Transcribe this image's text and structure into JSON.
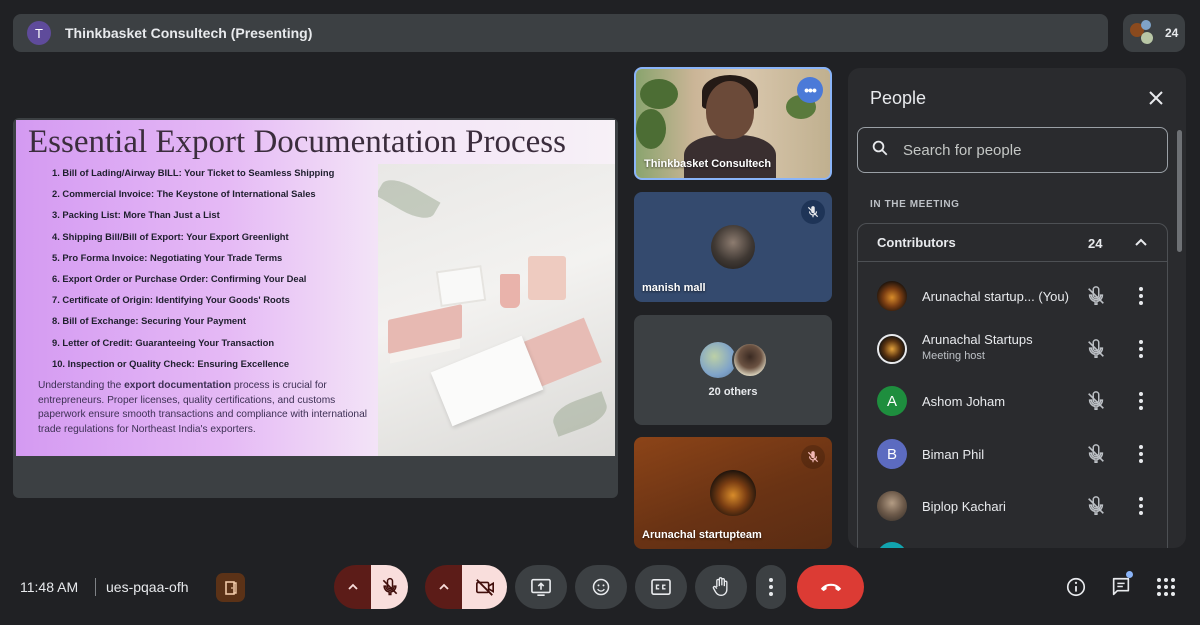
{
  "top_bar": {
    "presenter_initial": "T",
    "presenter_label": "Thinkbasket Consultech (Presenting)",
    "participant_count": "24"
  },
  "slide": {
    "title": "Essential Export Documentation Process",
    "items": [
      "1. Bill of Lading/Airway BILL: Your Ticket to Seamless Shipping",
      "2. Commercial Invoice: The Keystone of International Sales",
      "3. Packing List: More Than Just a List",
      "4. Shipping Bill/Bill of Export: Your Export Greenlight",
      "5. Pro Forma Invoice: Negotiating Your Trade Terms",
      "6. Export Order or Purchase Order: Confirming Your Deal",
      "7. Certificate of Origin: Identifying Your Goods' Roots",
      "8. Bill of Exchange: Securing Your Payment",
      "9. Letter of Credit: Guaranteeing Your Transaction",
      "10. Inspection or Quality Check: Ensuring Excellence"
    ],
    "para_before": "Understanding the ",
    "para_bold": "export documentation",
    "para_after": " process is crucial for entrepreneurs. Proper licenses, quality certifications, and customs paperwork ensure smooth transactions and compliance with international trade regulations for Northeast India's exporters."
  },
  "tiles": {
    "tile1_name": "Thinkbasket Consultech",
    "tile2_name": "manish mall",
    "tile3_label": "20 others",
    "tile4_name": "Arunachal startupteam"
  },
  "people_panel": {
    "title": "People",
    "search_placeholder": "Search for people",
    "section_label": "IN THE MEETING",
    "group_title": "Contributors",
    "group_count": "24",
    "people": [
      {
        "name": "Arunachal startup...",
        "suffix": "(You)",
        "sub": "",
        "initial": "",
        "color": "#3a2a1c"
      },
      {
        "name": "Arunachal Startups",
        "suffix": "",
        "sub": "Meeting host",
        "initial": "",
        "color": "#1a1a1a"
      },
      {
        "name": "Ashom Joham",
        "suffix": "",
        "sub": "",
        "initial": "A",
        "color": "#1e8e3e"
      },
      {
        "name": "Biman Phil",
        "suffix": "",
        "sub": "",
        "initial": "B",
        "color": "#5c6bc0"
      },
      {
        "name": "Biplop Kachari",
        "suffix": "",
        "sub": "",
        "initial": "",
        "color": "#6d5a4a"
      }
    ]
  },
  "bottom_bar": {
    "time": "11:48 AM",
    "meeting_code": "ues-pqaa-ofh"
  }
}
